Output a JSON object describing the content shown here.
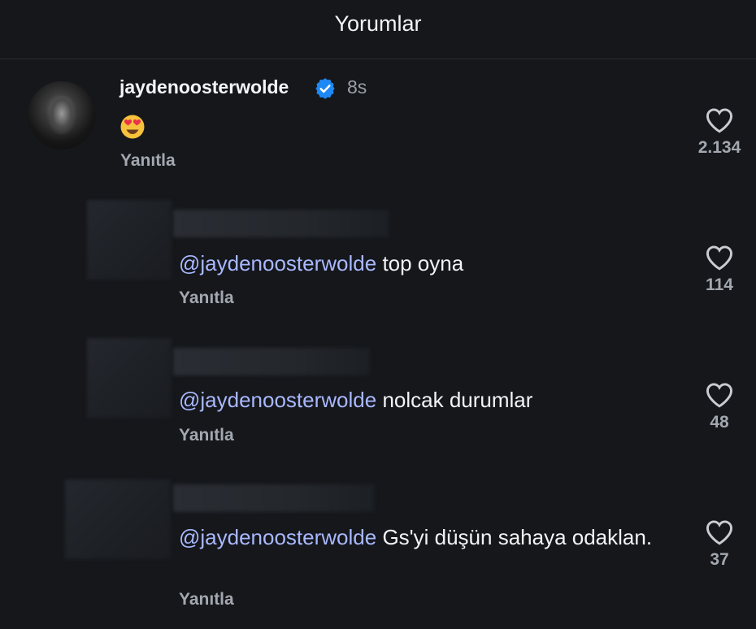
{
  "header": {
    "title": "Yorumlar"
  },
  "main_comment": {
    "username": "jaydenoosterwolde",
    "time_ago": "8s",
    "emoji": "heart-eyes",
    "reply_label": "Yanıtla",
    "likes": "2.134"
  },
  "replies": [
    {
      "mention": "@jaydenoosterwolde",
      "text": " top oyna",
      "reply_label": "Yanıtla",
      "likes": "114"
    },
    {
      "mention": "@jaydenoosterwolde",
      "text": " nolcak durumlar",
      "reply_label": "Yanıtla",
      "likes": "48"
    },
    {
      "mention": "@jaydenoosterwolde",
      "text": " Gs'yi düşün sahaya odaklan.",
      "reply_label": "Yanıtla",
      "likes": "37"
    }
  ],
  "colors": {
    "background": "#15171b",
    "mention": "#a9b8ff",
    "verified": "#1e88f5",
    "muted": "#a3a8b0"
  }
}
